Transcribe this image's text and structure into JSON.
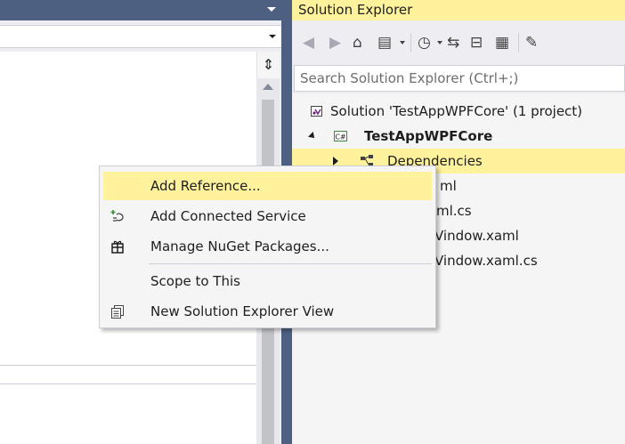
{
  "solution_explorer": {
    "title": "Solution Explorer",
    "search_placeholder": "Search Solution Explorer (Ctrl+;)",
    "toolbar_icons": [
      "back-icon",
      "forward-icon",
      "home-icon",
      "switch-views-icon",
      "pending-changes-icon",
      "sync-icon",
      "collapse-all-icon",
      "show-all-files-icon",
      "properties-icon"
    ],
    "tree": {
      "solution_label": "Solution 'TestAppWPFCore' (1 project)",
      "project_label": "TestAppWPFCore",
      "dependencies_label": "Dependencies",
      "partial_items": [
        "ml",
        "ml.cs",
        "Vindow.xaml",
        "Vindow.xaml.cs"
      ]
    }
  },
  "context_menu": {
    "items": [
      {
        "label": "Add Reference...",
        "icon": null,
        "highlighted": true
      },
      {
        "label": "Add Connected Service",
        "icon": "connected-service-icon"
      },
      {
        "label": "Manage NuGet Packages...",
        "icon": "nuget-package-icon"
      },
      {
        "label": "Scope to This",
        "icon": null
      },
      {
        "label": "New Solution Explorer View",
        "icon": "new-view-icon"
      }
    ]
  },
  "colors": {
    "accent_yellow": "#fff29d",
    "title_bar_blue": "#4d6082",
    "background": "#eeeef2"
  }
}
